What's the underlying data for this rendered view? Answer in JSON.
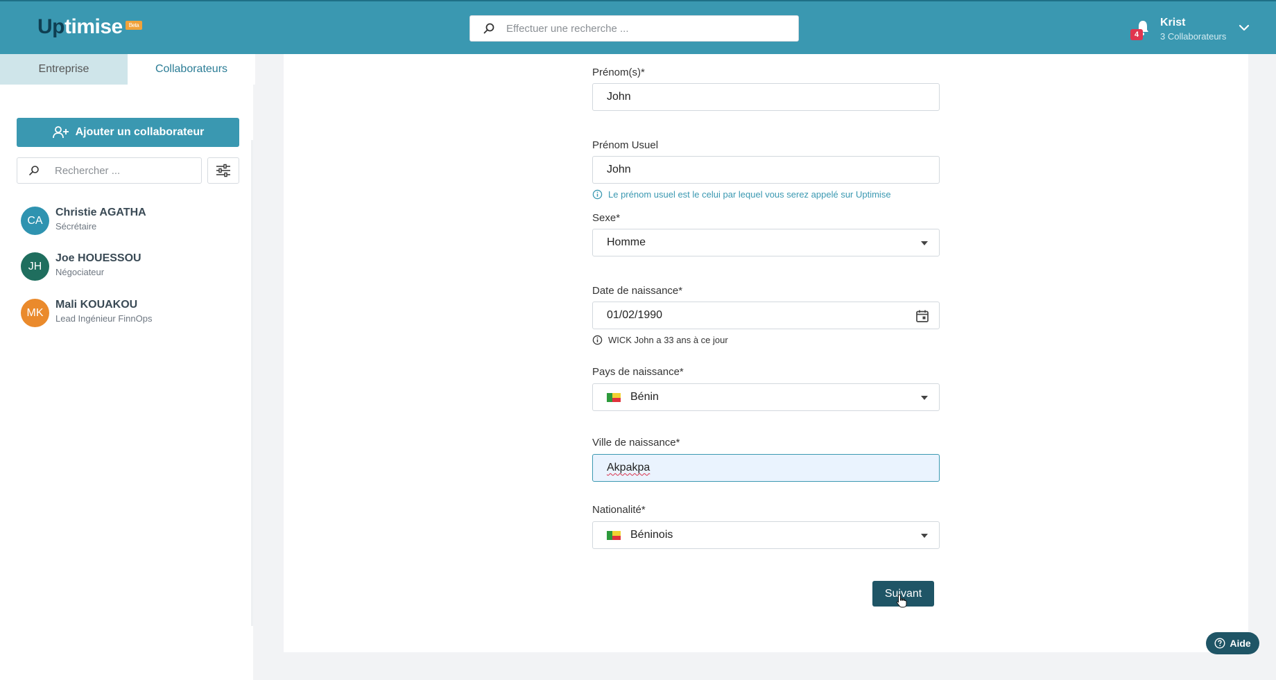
{
  "header": {
    "logo_up": "Up",
    "logo_rest": "timise",
    "logo_badge": "Beta",
    "search_placeholder": "Effectuer une recherche ...",
    "notification_count": "4",
    "user_name": "Krist",
    "user_sub": "3 Collaborateurs"
  },
  "sidebar": {
    "tabs": [
      {
        "label": "Entreprise",
        "active": false
      },
      {
        "label": "Collaborateurs",
        "active": true
      }
    ],
    "add_button_label": "Ajouter un collaborateur",
    "search_placeholder": "Rechercher ...",
    "people": [
      {
        "initials": "CA",
        "name": "Christie AGATHA",
        "role": "Sécrétaire",
        "color": "#2f93b0"
      },
      {
        "initials": "JH",
        "name": "Joe HOUESSOU",
        "role": "Négociateur",
        "color": "#1f6e5e"
      },
      {
        "initials": "MK",
        "name": "Mali KOUAKOU",
        "role": "Lead Ingénieur FinnOps",
        "color": "#ea8a2c"
      }
    ]
  },
  "form": {
    "prenoms": {
      "label": "Prénom(s)*",
      "value": "John"
    },
    "prenom_usuel": {
      "label": "Prénom Usuel",
      "value": "John",
      "hint": "Le prénom usuel est le celui par lequel vous serez appelé sur Uptimise"
    },
    "sexe": {
      "label": "Sexe*",
      "value": "Homme"
    },
    "date_naissance": {
      "label": "Date de naissance*",
      "value": "01/02/1990",
      "hint": "WICK John a 33 ans à ce jour"
    },
    "pays_naissance": {
      "label": "Pays de naissance*",
      "value": "Bénin"
    },
    "ville_naissance": {
      "label": "Ville de naissance*",
      "value": "Akpakpa"
    },
    "nationalite": {
      "label": "Nationalité*",
      "value": "Béninois"
    },
    "next_button": "Suivant"
  },
  "help_button": "Aide",
  "colors": {
    "header": "#3a98b1",
    "primary_dark": "#1f5566",
    "badge": "#e0354f"
  }
}
